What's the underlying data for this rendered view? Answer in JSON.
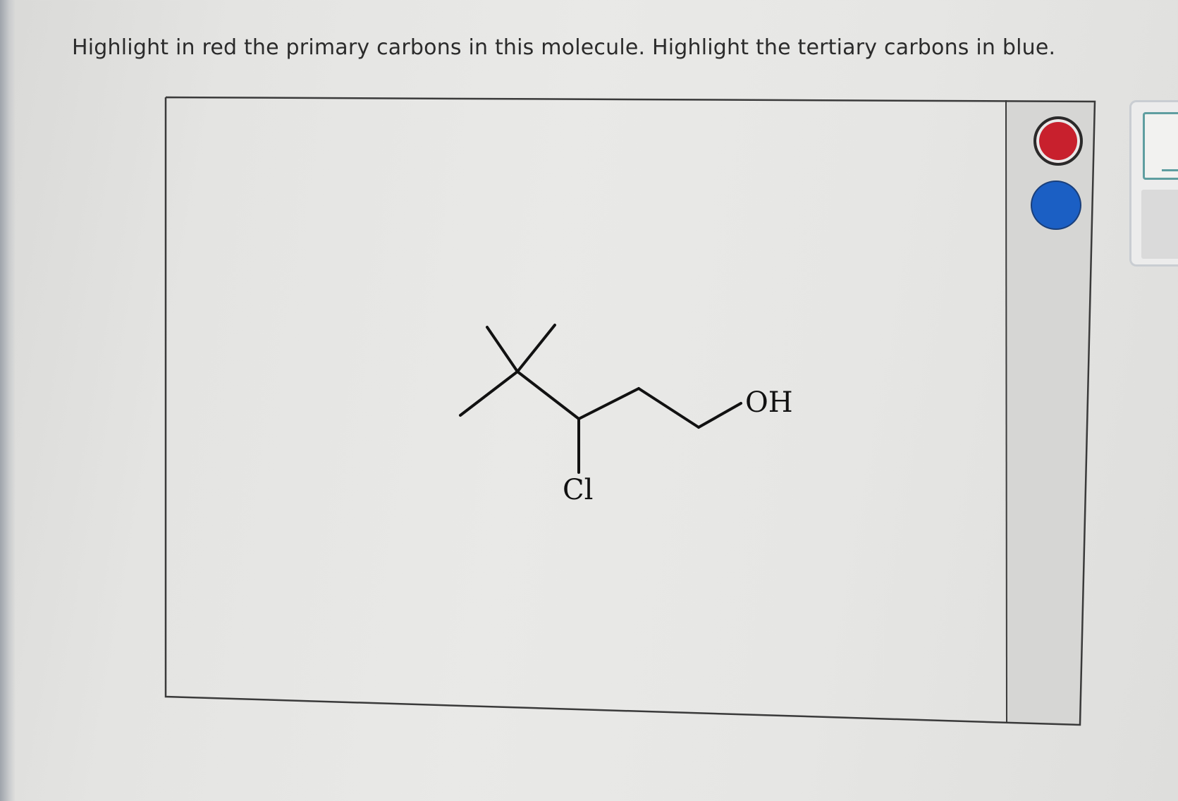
{
  "prompt": {
    "text": "Highlight in red the primary carbons in this molecule. Highlight the tertiary carbons in blue."
  },
  "molecule": {
    "atom_labels": {
      "hydroxyl": "OH",
      "chlorine": "Cl"
    }
  },
  "tools": {
    "highlight_colors": [
      {
        "name": "red",
        "color": "#c8202d",
        "selected": true
      },
      {
        "name": "blue",
        "color": "#1b5fc4",
        "selected": false
      }
    ]
  }
}
